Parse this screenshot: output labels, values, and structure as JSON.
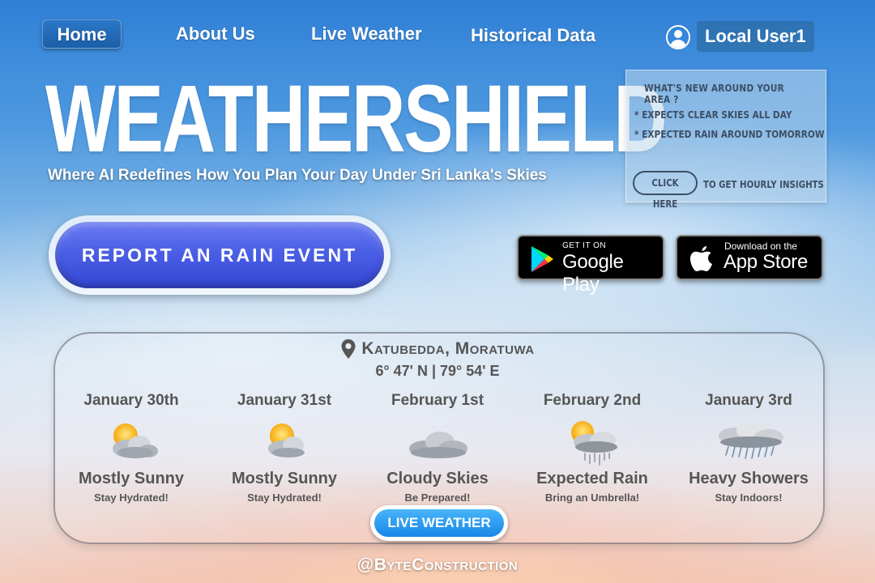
{
  "nav": {
    "home": "Home",
    "about": "About Us",
    "live": "Live Weather",
    "historical": "Historical Data",
    "user": "Local User1"
  },
  "hero": {
    "brand": "WEATHERSHIELD",
    "tagline": "Where AI Redefines How You Plan Your Day Under Sri Lanka's Skies"
  },
  "news": {
    "title": "WHAT'S NEW AROUND YOUR AREA ?",
    "items": [
      "* EXPECTS CLEAR SKIES ALL DAY",
      "* EXPECTED RAIN AROUND TOMORROW"
    ],
    "button": "CLICK HERE",
    "note": "TO GET HOURLY INSIGHTS"
  },
  "report_button": "REPORT AN RAIN EVENT",
  "stores": {
    "google": {
      "small": "GET IT ON",
      "big": "Google Play"
    },
    "apple": {
      "small": "Download on the",
      "big": "App Store"
    }
  },
  "location": {
    "name": "Katubedda, Moratuwa",
    "coords": "6° 47' N | 79° 54' E"
  },
  "forecast": [
    {
      "date": "January 30th",
      "icon": "partly-sunny-icon",
      "condition": "Mostly Sunny",
      "tip": "Stay Hydrated!"
    },
    {
      "date": "January 31st",
      "icon": "partly-sunny-icon",
      "condition": "Mostly Sunny",
      "tip": "Stay Hydrated!"
    },
    {
      "date": "February 1st",
      "icon": "cloud-icon",
      "condition": "Cloudy Skies",
      "tip": "Be Prepared!"
    },
    {
      "date": "February 2nd",
      "icon": "sun-rain-icon",
      "condition": "Expected Rain",
      "tip": "Bring an Umbrella!"
    },
    {
      "date": "January 3rd",
      "icon": "heavy-rain-icon",
      "condition": "Heavy Showers",
      "tip": "Stay Indoors!"
    }
  ],
  "live_button": "LIVE WEATHER",
  "footer": "@ByteConstruction"
}
